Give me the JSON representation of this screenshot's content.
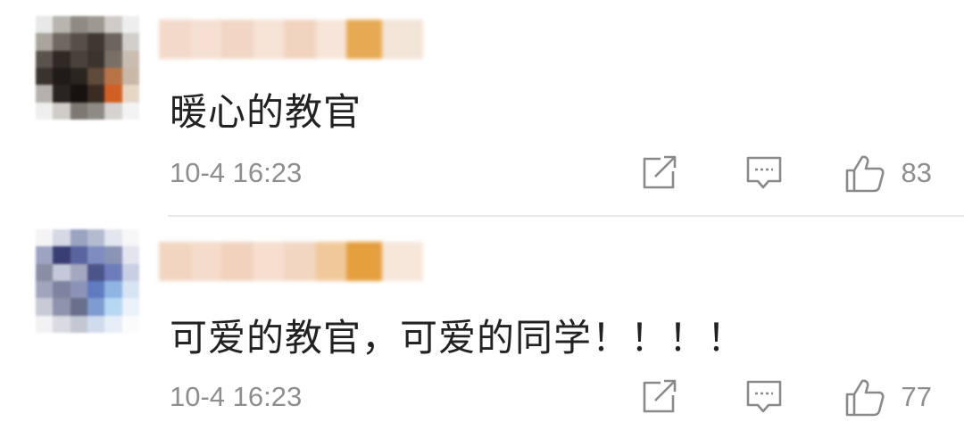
{
  "comments": [
    {
      "text": "暖心的教官",
      "time": "10-4 16:23",
      "likes": "83",
      "avatar_colors": [
        "#e8e8e8",
        "#b8b4ae",
        "#8f8a83",
        "#9d9890",
        "#cfcbc6",
        "#eeeeee",
        "#a9a49c",
        "#6e6860",
        "#574f47",
        "#3e3833",
        "#6c655d",
        "#d2cfca",
        "#5a534c",
        "#2f2a26",
        "#4a423a",
        "#3b342e",
        "#7a6f66",
        "#c9bdb1",
        "#3a332d",
        "#1f1b18",
        "#2b2520",
        "#5e4a3a",
        "#b87444",
        "#c9b8a7",
        "#b5b1ac",
        "#2a2420",
        "#16120f",
        "#3b2c22",
        "#d15f24",
        "#e7d6c6",
        "#efefef",
        "#cfcbc6",
        "#7d7872",
        "#8e8a85",
        "#d5d2cf",
        "#f3f3f3"
      ],
      "name_colors": [
        "#f3d9c9",
        "#f6e0d3",
        "#f2d6c3",
        "#f7e2d6",
        "#f1d4c0",
        "#f8e5da",
        "#e6aa52",
        "#f3e4d8"
      ]
    },
    {
      "text": "可爱的教官，可爱的同学！！！！",
      "time": "10-4 16:23",
      "likes": "77",
      "avatar_colors": [
        "#f4f4f6",
        "#d6d8e4",
        "#9aa3c2",
        "#b3bccf",
        "#e2e6ee",
        "#f7f7f8",
        "#9ea3c1",
        "#3a3f73",
        "#5a64a0",
        "#7e8cc0",
        "#8b93b6",
        "#e2e4ee",
        "#8a8ea4",
        "#c5c8d8",
        "#a3a8c0",
        "#4c548a",
        "#6d7dbb",
        "#c9cfe3",
        "#a1a5bc",
        "#7d83a0",
        "#8c93b8",
        "#607bc0",
        "#8fb5e2",
        "#d6e4f4",
        "#c8cad6",
        "#8f93ac",
        "#6a6f8c",
        "#7f9cd0",
        "#b7d7f3",
        "#eaf2fa",
        "#f2f2f4",
        "#dadbe2",
        "#c3c7d3",
        "#d0dced",
        "#e7eef7",
        "#fbfbfc"
      ],
      "name_colors": [
        "#f2d5c0",
        "#f5dbc9",
        "#f1d2bc",
        "#f6dfcf",
        "#f2d6c2",
        "#f0c99a",
        "#e59f3d",
        "#f6e7da"
      ]
    }
  ]
}
